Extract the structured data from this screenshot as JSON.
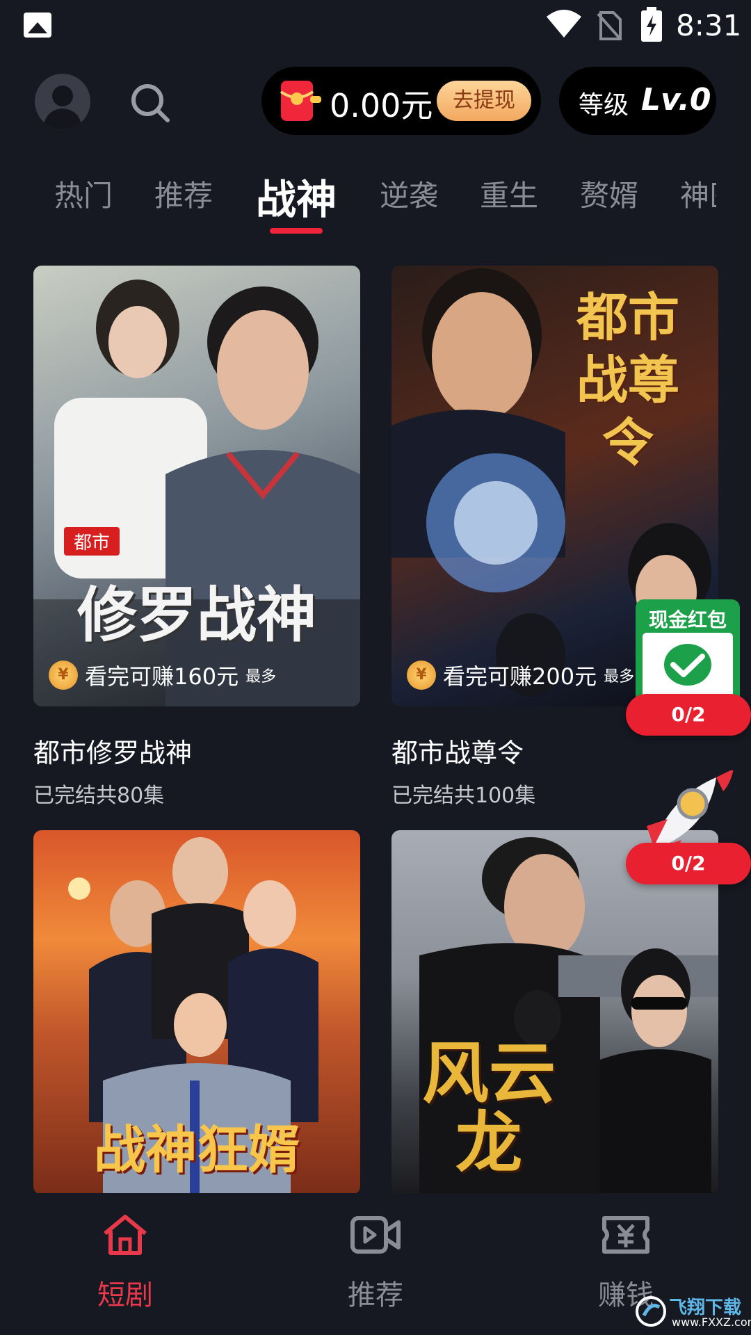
{
  "status_bar": {
    "time": "8:31",
    "icons": [
      "gallery-icon",
      "wifi-icon",
      "no-sim-icon",
      "battery-charging-icon"
    ]
  },
  "header": {
    "balance": "0.00元",
    "withdraw_label": "去提现",
    "level_label": "等级",
    "level_value": "Lv.0"
  },
  "tabs": [
    {
      "label": "热门"
    },
    {
      "label": "推荐"
    },
    {
      "label": "战神",
      "active": true
    },
    {
      "label": "逆袭"
    },
    {
      "label": "重生"
    },
    {
      "label": "赘婿"
    },
    {
      "label": "神医"
    }
  ],
  "cards": [
    {
      "poster_tag": "都市",
      "poster_title": "修罗战神",
      "earn_text": "看完可赚160元",
      "earn_max": "最多",
      "title": "都市修罗战神",
      "subtitle": "已完结共80集"
    },
    {
      "poster_title": "都市战尊令",
      "earn_text": "看完可赚200元",
      "earn_max": "最多",
      "title": "都市战尊令",
      "subtitle": "已完结共100集"
    },
    {
      "poster_title": "战神狂婿"
    },
    {
      "poster_title": "风云龙"
    }
  ],
  "floating": {
    "cash_packet_title": "现金红包",
    "cash_packet_progress": "0/2",
    "rocket_progress": "0/2"
  },
  "bottom_nav": [
    {
      "label": "短剧",
      "icon": "home-icon",
      "active": true
    },
    {
      "label": "推荐",
      "icon": "video-icon"
    },
    {
      "label": "赚钱",
      "icon": "ticket-icon"
    }
  ],
  "watermark": {
    "text": "飞翔下载",
    "url": "www.FXXZ.com"
  },
  "colors": {
    "accent": "#e8394a",
    "background": "#161822",
    "withdraw_gold": "#f2a860"
  }
}
